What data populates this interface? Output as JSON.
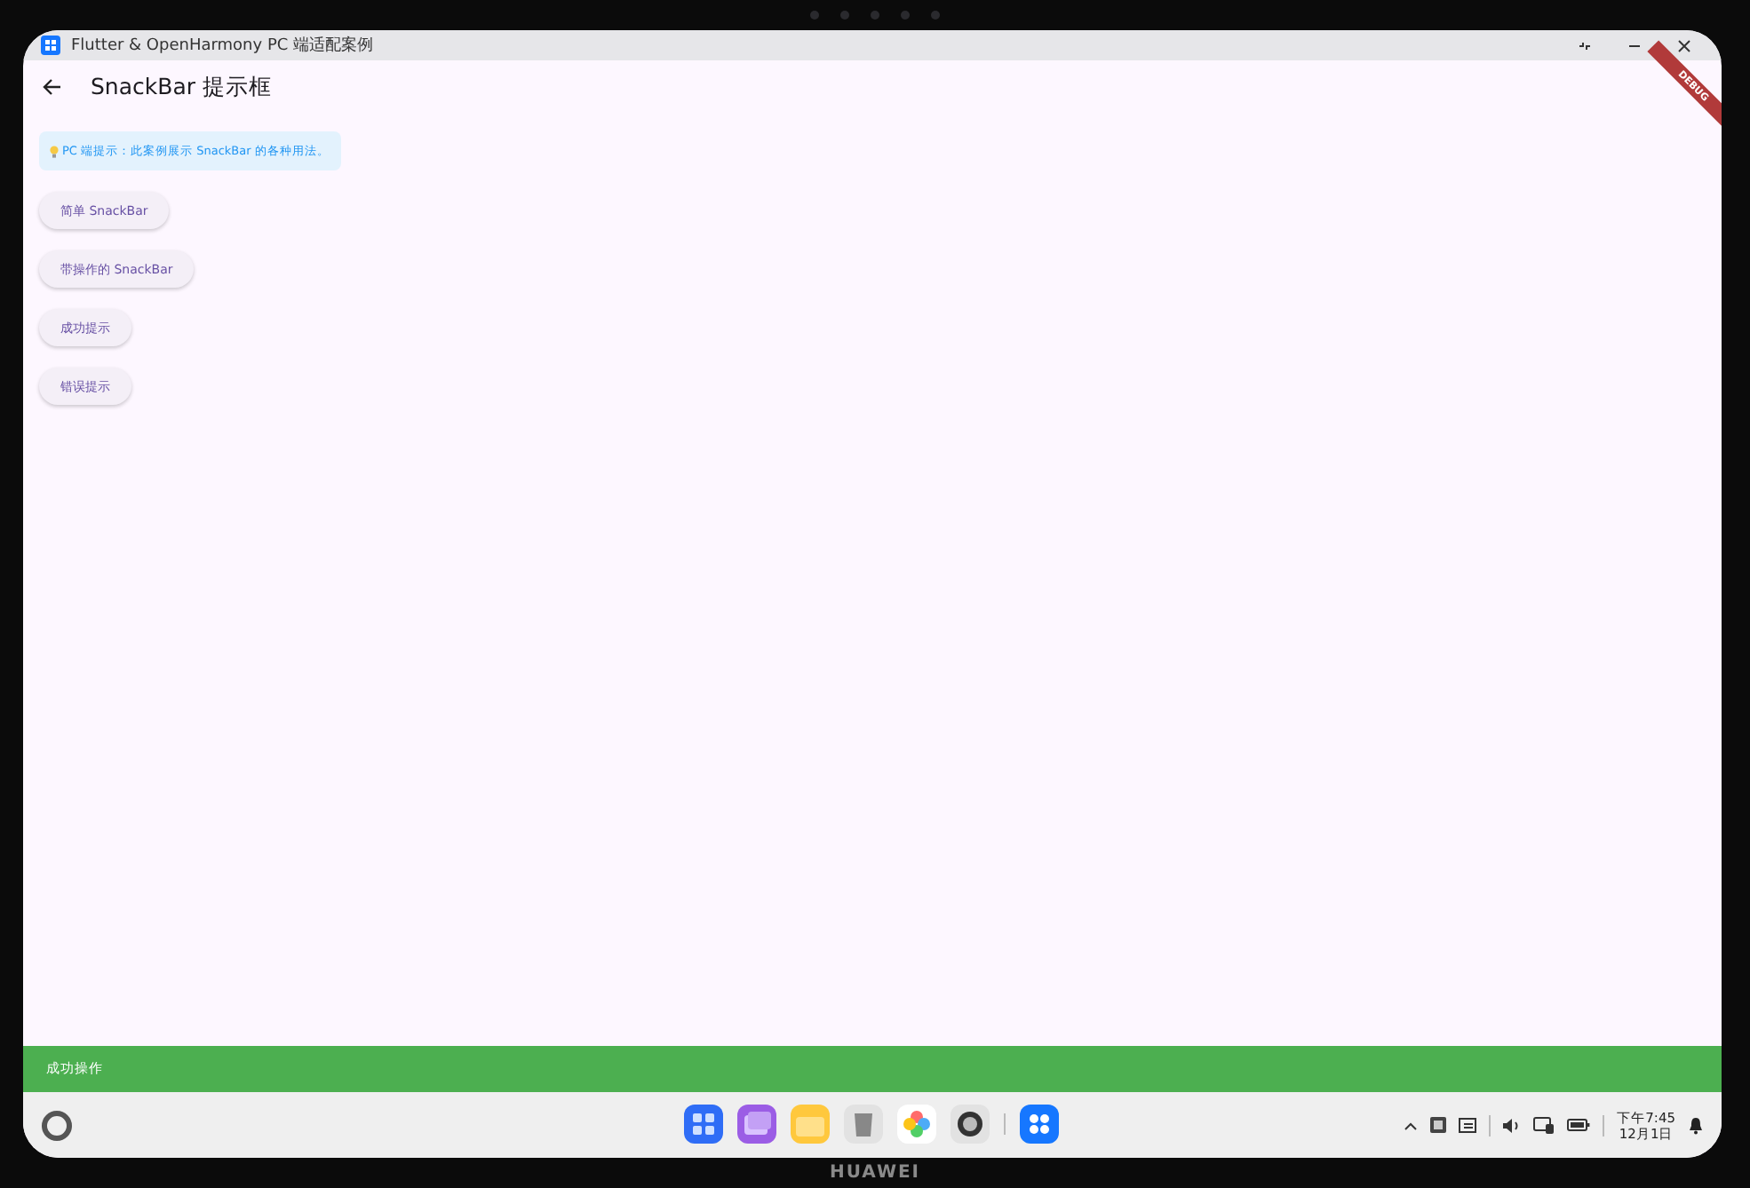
{
  "window": {
    "title": "Flutter & OpenHarmony PC 端适配案例"
  },
  "app_bar": {
    "title": "SnackBar 提示框"
  },
  "debug_banner": "DEBUG",
  "tip": "PC 端提示：此案例展示 SnackBar 的各种用法。",
  "buttons": [
    "简单 SnackBar",
    "带操作的 SnackBar",
    "成功提示",
    "错误提示"
  ],
  "snackbar": {
    "message": "成功操作"
  },
  "taskbar": {
    "time": "下午7:45",
    "date": "12月1日"
  },
  "device": {
    "brand": "HUAWEI"
  }
}
